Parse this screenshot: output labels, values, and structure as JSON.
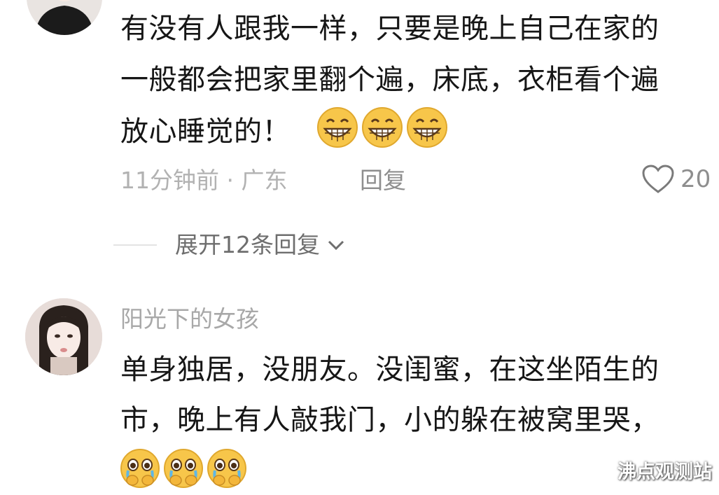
{
  "comments": [
    {
      "avatar_icon": "user-avatar-photo",
      "lines": [
        "有没有人跟我一样，只要是晚上自己在家的",
        "一般都会把家里翻个遍，床底，衣柜看个遍",
        "放心睡觉的！"
      ],
      "emoji": "grinning-face-icon",
      "time_location": "11分钟前 · 广东",
      "reply_label": "回复",
      "likes": "20",
      "expand_label": "展开12条回复"
    },
    {
      "avatar_icon": "user-avatar-photo",
      "username": "阳光下的女孩",
      "lines": [
        "单身独居，没朋友。没闺蜜，在这坐陌生的",
        "市，晚上有人敲我门，小的躲在被窝里哭，"
      ],
      "emoji": "pleading-crying-face-icon"
    }
  ],
  "watermark": "沸点观测站",
  "colors": {
    "text": "#161616",
    "meta": "#b2b2b2",
    "emoji_yellow": "#f7c64a"
  }
}
